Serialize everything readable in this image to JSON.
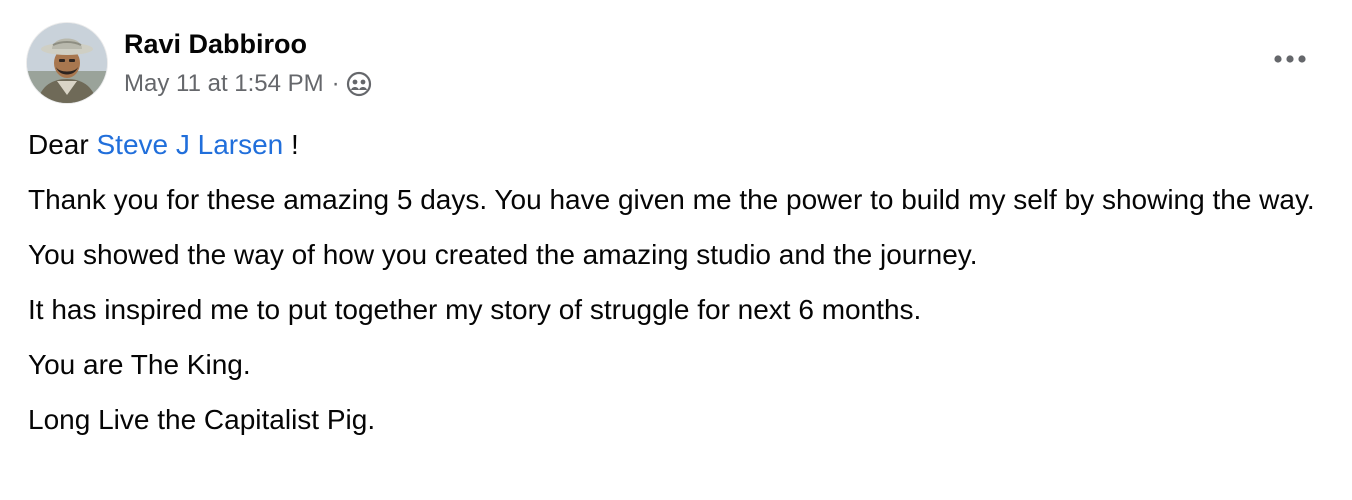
{
  "post": {
    "author": {
      "name": "Ravi Dabbiroo",
      "avatar_icon": "profile-photo-avatar"
    },
    "timestamp": "May 11 at 1:54 PM",
    "separator": "·",
    "privacy_icon": "friends-audience-icon",
    "more_icon": "more-options-icon",
    "greeting": {
      "prefix": "Dear",
      "mention": "Steve J Larsen",
      "suffix": "!"
    },
    "paragraphs": [
      "Thank you for these amazing 5 days. You have given me the power to build my self by showing the way.",
      "You showed the way of how you created the amazing studio and the journey.",
      "It has inspired me to put together my story of struggle for next 6 months.",
      "You are The King.",
      "Long Live the Capitalist Pig."
    ]
  },
  "colors": {
    "text": "#050505",
    "secondary_text": "#65676b",
    "mention_link": "#216fdb",
    "background": "#ffffff"
  }
}
